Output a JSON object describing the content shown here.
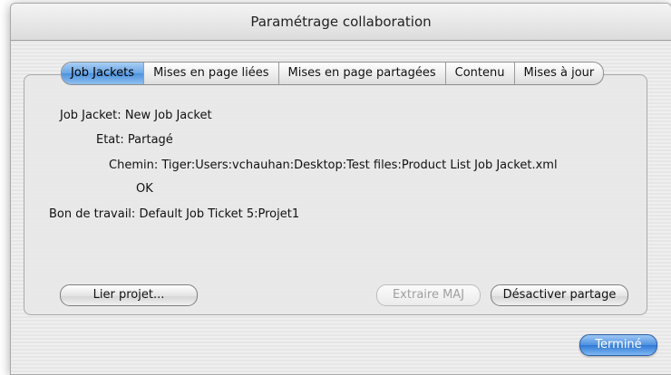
{
  "window": {
    "title": "Paramétrage collaboration"
  },
  "tabs": [
    {
      "label": "Job Jackets",
      "active": true
    },
    {
      "label": "Mises en page liées",
      "active": false
    },
    {
      "label": "Mises en page partagées",
      "active": false
    },
    {
      "label": "Contenu",
      "active": false
    },
    {
      "label": "Mises à jour",
      "active": false
    }
  ],
  "details": {
    "job_jacket_label": "Job Jacket:",
    "job_jacket_value": "New Job Jacket",
    "etat_label": "Etat:",
    "etat_value": "Partagé",
    "chemin_label": "Chemin:",
    "chemin_value": "Tiger:Users:vchauhan:Desktop:Test files:Product List Job Jacket.xml",
    "status_value": "OK",
    "bon_label": "Bon de travail:",
    "bon_value": "Default Job Ticket 5:Projet1"
  },
  "buttons": {
    "lier_projet": "Lier projet...",
    "extraire_maj": "Extraire MAJ",
    "desactiver_partage": "Désactiver partage",
    "termine": "Terminé"
  }
}
